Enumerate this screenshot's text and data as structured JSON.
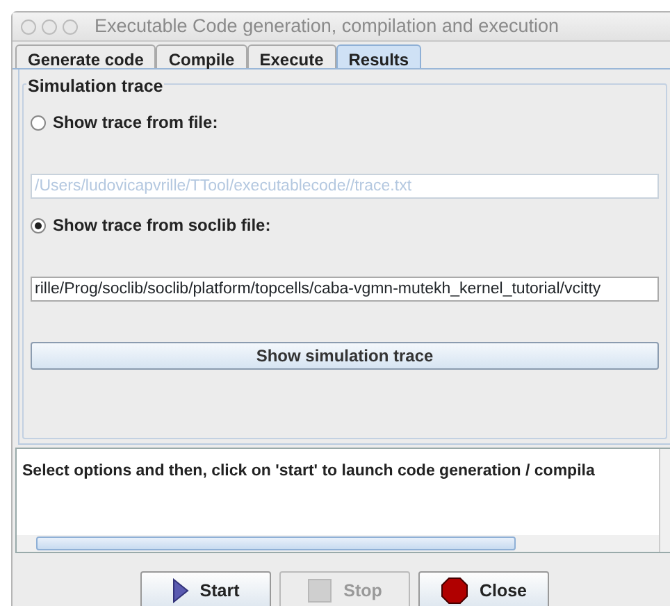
{
  "window": {
    "title": "Executable Code generation, compilation and execution"
  },
  "tabs": [
    {
      "label": "Generate code",
      "selected": false
    },
    {
      "label": "Compile",
      "selected": false
    },
    {
      "label": "Execute",
      "selected": false
    },
    {
      "label": "Results",
      "selected": true
    }
  ],
  "group": {
    "title": "Simulation trace"
  },
  "options": [
    {
      "label": "Show trace from file:",
      "selected": false,
      "path": "/Users/ludovicapvrille/TTool/executablecode//trace.txt",
      "disabled": true
    },
    {
      "label": "Show trace from soclib file:",
      "selected": true,
      "path": "rille/Prog/soclib/soclib/platform/topcells/caba-vgmn-mutekh_kernel_tutorial/vcitty",
      "disabled": false
    }
  ],
  "show_button": "Show simulation trace",
  "output": {
    "text": "Select options and then, click on 'start' to launch code generation / compila"
  },
  "buttons": [
    {
      "kind": "start",
      "label": "Start",
      "disabled": false
    },
    {
      "kind": "stop",
      "label": "Stop",
      "disabled": true
    },
    {
      "kind": "close",
      "label": "Close",
      "disabled": false
    }
  ]
}
